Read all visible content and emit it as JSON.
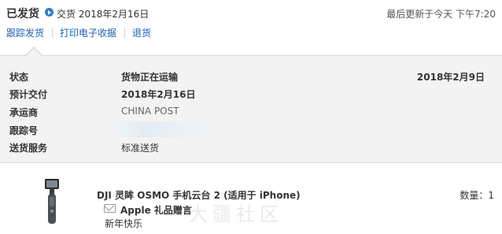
{
  "header": {
    "status_title": "已发货",
    "status_sub": "交货 2018年2月16日",
    "last_updated": "最后更新于今天 下午7:20"
  },
  "actions": {
    "track": "跟踪发货",
    "print_receipt": "打印电子收据",
    "return": "退货"
  },
  "details": {
    "status_label": "状态",
    "status_value": "货物正在运输",
    "status_date": "2018年2月9日",
    "eta_label": "预计交付",
    "eta_value": "2018年2月16日",
    "carrier_label": "承运商",
    "carrier_value": "CHINA POST",
    "tracking_label": "跟踪号",
    "service_label": "送货服务",
    "service_value": "标准送货"
  },
  "product": {
    "name": "DJI 灵眸 OSMO 手机云台 2 (适用于 iPhone)",
    "quantity": "数量：1",
    "gift_label": "Apple 礼品赠言",
    "gift_message": "新年快乐"
  },
  "watermark": "大疆社区",
  "colors": {
    "link": "#1a5fb4",
    "status_icon": "#2c7fc8",
    "panel_bg": "#f3f3f3"
  },
  "icons": {
    "status": "play-circle-icon",
    "gift": "envelope-icon"
  }
}
